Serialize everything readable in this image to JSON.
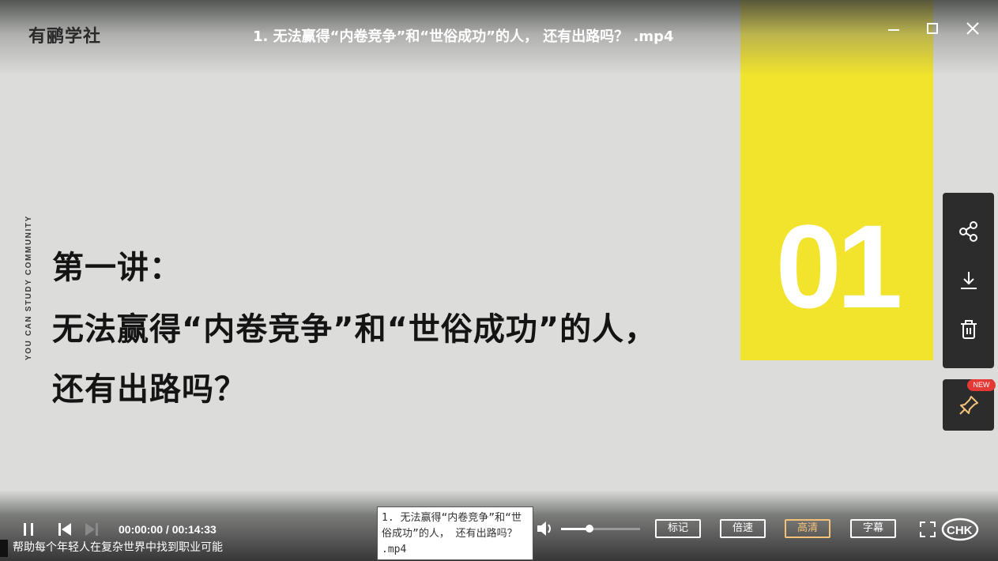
{
  "app": {
    "logo_text": "有鹂学社",
    "window_title": "1. 无法赢得“内卷竞争”和“世俗成功”的人， 还有出路吗？  .mp4"
  },
  "window_controls": {
    "minimize": "—",
    "maximize": "☐",
    "close": "✕"
  },
  "slide": {
    "vertical_text": "YOU CAN STUDY COMMUNITY",
    "heading_line1": "第一讲：",
    "heading_line2": "无法赢得“内卷竞争”和“世俗成功”的人，",
    "heading_line3": "还有出路吗？",
    "big_number": "01",
    "accent_color": "#f2e32c"
  },
  "side_panel": {
    "items": [
      "share-icon",
      "download-icon",
      "trash-icon"
    ],
    "pin_badge": "NEW"
  },
  "controls": {
    "current_time": "00:00:00",
    "separator": " / ",
    "duration": "00:14:33",
    "volume_level": 0.36,
    "buttons": {
      "mark": "标记",
      "speed": "倍速",
      "quality": "高清",
      "subtitle": "字幕"
    },
    "tooltip_text": "1. 无法赢得“内卷竞争”和“世俗成功”的人， 还有出路吗？ .mp4",
    "marquee_text": "帮助每个年轻人在复杂世界中找到职业可能"
  }
}
